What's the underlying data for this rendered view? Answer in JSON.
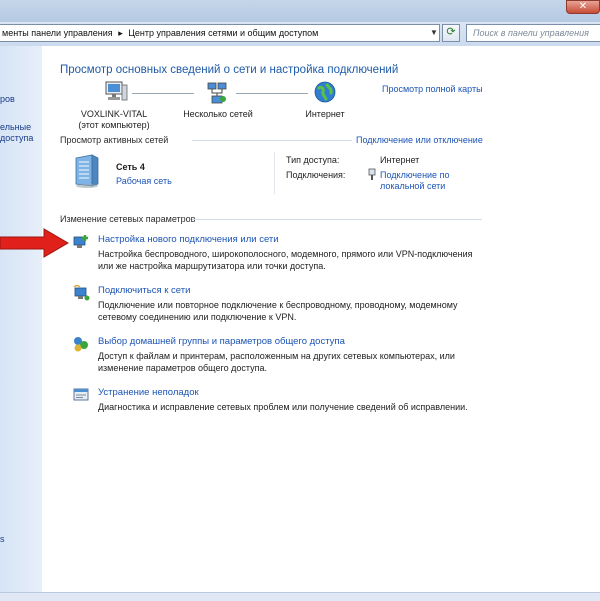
{
  "address": {
    "breadcrumbs": [
      "менты панели управления",
      "Центр управления сетями и общим доступом"
    ],
    "separator": "▸",
    "search_placeholder": "Поиск в панели управления"
  },
  "leftnav": {
    "fragments": [
      "ров",
      "ельные",
      "доступа",
      "s"
    ]
  },
  "main": {
    "title": "Просмотр основных сведений о сети и настройка подключений",
    "full_map_link": "Просмотр полной карты",
    "map": {
      "computer_name": "VOXLINK-VITAL",
      "computer_sub": "(этот компьютер)",
      "networks": "Несколько сетей",
      "internet": "Интернет"
    },
    "active_label": "Просмотр активных сетей",
    "connect_disconnect_link": "Подключение или отключение",
    "network": {
      "name": "Сеть  4",
      "type_link": "Рабочая сеть",
      "access_type_label": "Тип доступа:",
      "access_type_value": "Интернет",
      "connections_label": "Подключения:",
      "connections_link_1": "Подключение по",
      "connections_link_2": "локальной сети"
    },
    "change_label": "Изменение сетевых параметров",
    "tasks": [
      {
        "title": "Настройка нового подключения или сети",
        "desc1": "Настройка беспроводного, широкополосного, модемного, прямого или VPN-подключения",
        "desc2": "или же настройка маршрутизатора или точки доступа."
      },
      {
        "title": "Подключиться к сети",
        "desc1": "Подключение или повторное подключение к беспроводному, проводному, модемному",
        "desc2": "сетевому соединению или подключение к VPN."
      },
      {
        "title": "Выбор домашней группы и параметров общего доступа",
        "desc1": "Доступ к файлам и принтерам, расположенным на других сетевых компьютерах, или",
        "desc2": "изменение параметров общего доступа."
      },
      {
        "title": "Устранение неполадок",
        "desc1": "Диагностика и исправление сетевых проблем или получение сведений об исправлении.",
        "desc2": ""
      }
    ]
  },
  "icons": {
    "close": "close-icon",
    "refresh": "refresh-icon",
    "search": "search-icon",
    "annotation_arrow": "red-arrow-icon"
  },
  "colors": {
    "link": "#1b54b5",
    "heading": "#1e5aa8",
    "arrow": "#e0201a"
  }
}
